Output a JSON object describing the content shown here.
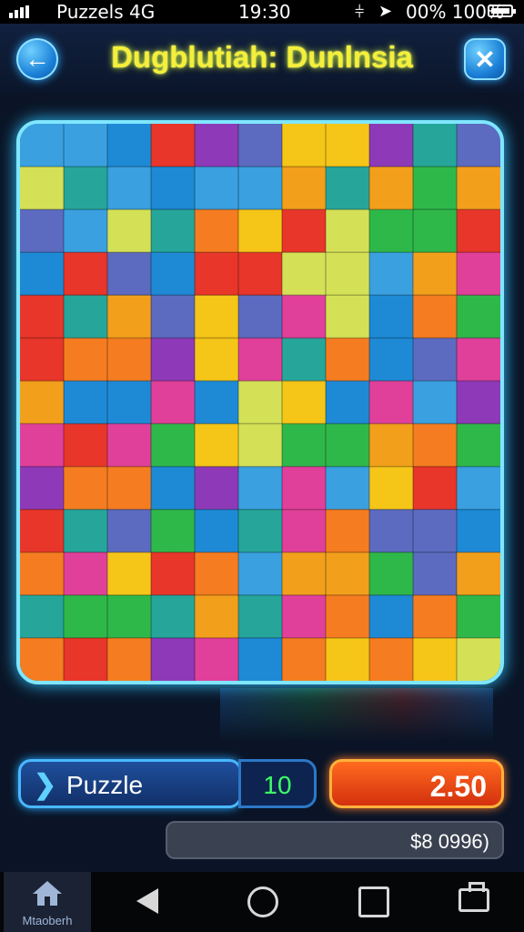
{
  "status_bar": {
    "carrier": "Puzzels 4G",
    "time": "19:30",
    "battery": "00% 100%"
  },
  "header": {
    "title": "Dugblutiah: Dunlnsia",
    "back_icon": "arrow-left-icon",
    "close_icon": "close-icon"
  },
  "board": {
    "colors": [
      "#e8362a",
      "#f57c20",
      "#f5c518",
      "#2fb84a",
      "#1e8ad6",
      "#3aa0e0",
      "#8e3ab8",
      "#e0409a",
      "#f29f1c",
      "#26a69a",
      "#d4e157",
      "#5c6bc0"
    ]
  },
  "controls": {
    "puzzle_label": "Puzzle",
    "count": "10",
    "price": "2.50",
    "coins": "$8 0996)"
  },
  "nav": {
    "home_label": "Mtaoberh"
  },
  "colors": {
    "accent_blue": "#2fc4ff",
    "title_yellow": "#f5ef3b",
    "price_orange": "#ff6a1e",
    "count_green": "#3cff66"
  }
}
